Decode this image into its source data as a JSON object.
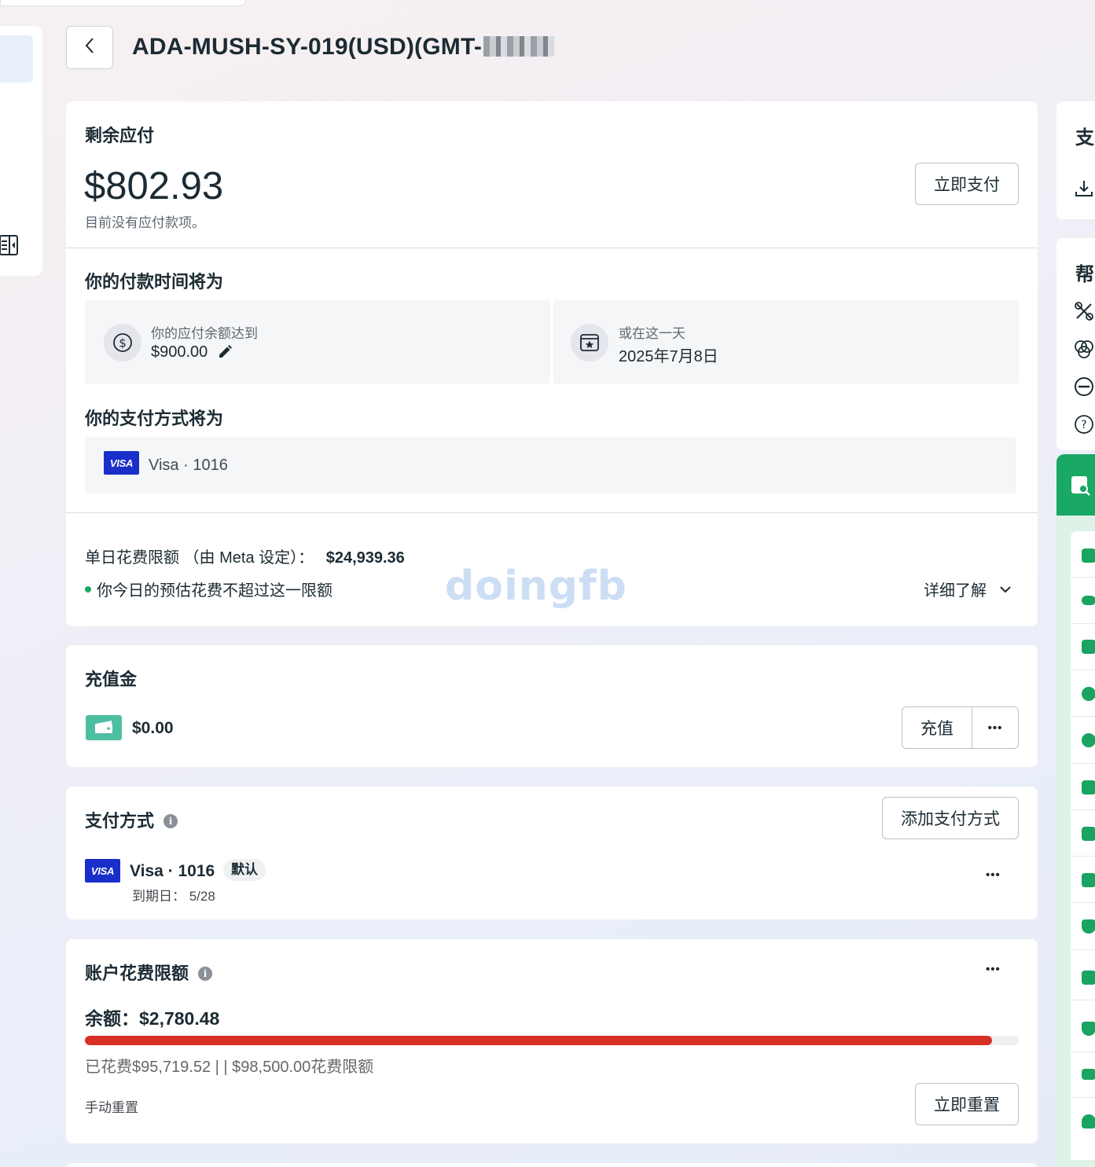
{
  "page": {
    "title": "ADA-MUSH-SY-019(USD)(GMT-"
  },
  "balance_due": {
    "heading": "剩余应付",
    "amount": "$802.93",
    "note": "目前没有应付款项。",
    "pay_button": "立即支付"
  },
  "payment_time": {
    "heading": "你的付款时间将为",
    "threshold_label": "你的应付余额达到",
    "threshold_value": "$900.00",
    "date_label": "或在这一天",
    "date_value": "2025年7月8日"
  },
  "payment_method_preview": {
    "heading": "你的支付方式将为",
    "card_brand": "VISA",
    "card_text": "Visa · 1016"
  },
  "daily_limit": {
    "label": "单日花费限额 （由 Meta 设定）：",
    "value": "$24,939.36",
    "note": "你今日的预估花费不超过这一限额",
    "learn_more": "详细了解",
    "status_color": "#1aa865"
  },
  "watermark": "doingfb",
  "prepaid": {
    "heading": "充值金",
    "amount": "$0.00",
    "topup_button": "充值",
    "more": "•••"
  },
  "payment_methods": {
    "heading": "支付方式",
    "add_button": "添加支付方式",
    "card_brand": "VISA",
    "card_name": "Visa · 1016",
    "default_badge": "默认",
    "expiry": "到期日：  5/28",
    "more": "•••"
  },
  "spending_limit": {
    "heading": "账户花费限额",
    "remaining": "余额：$2,780.48",
    "spent_fraction": 0.9718,
    "bar_color": "#d93025",
    "summary": "已花费$95,719.52 | | $98,500.00花费限额",
    "manual_reset_label": "手动重置",
    "reset_button": "立即重置",
    "more": "•••"
  },
  "right_panel": {
    "card1_heading": "支",
    "card2_heading": "帮",
    "accent_color": "#1aa865"
  }
}
